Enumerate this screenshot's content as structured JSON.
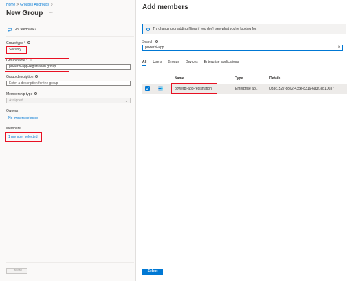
{
  "breadcrumb": {
    "home": "Home",
    "sep1": ">",
    "groups": "Groups | All groups",
    "sep2": ">"
  },
  "page_title": "New Group",
  "more_label": "...",
  "feedback_label": "Got feedback?",
  "form": {
    "group_type_label": "Group type *",
    "group_type_value": "Security",
    "group_name_label": "Group name *",
    "group_name_value": "powerbi-app-registration group",
    "group_description_label": "Group description",
    "group_description_placeholder": "Enter a description for the group",
    "membership_type_label": "Membership type",
    "membership_type_value": "Assigned",
    "owners_label": "Owners",
    "owners_link": "No owners selected",
    "members_label": "Members",
    "members_link": "1 member selected",
    "create_label": "Create"
  },
  "panel": {
    "title": "Add members",
    "info_text": "Try changing or adding filters if you don't see what you're looking for.",
    "search_label": "Search",
    "search_value": "powerbi-app",
    "tabs": [
      "All",
      "Users",
      "Groups",
      "Devices",
      "Enterprise applications"
    ],
    "active_tab": "All",
    "columns": {
      "name": "Name",
      "type": "Type",
      "details": "Details"
    },
    "rows": [
      {
        "name": "powerbi-app-registration",
        "type": "Enterprise ap...",
        "details": "033c1527-dde2-435e-8316-6a3f1eb10037",
        "checked": true
      }
    ],
    "select_label": "Select"
  },
  "colors": {
    "accent": "#0078d4",
    "highlight": "#e81123",
    "left_edge": "#1f3b6e"
  }
}
